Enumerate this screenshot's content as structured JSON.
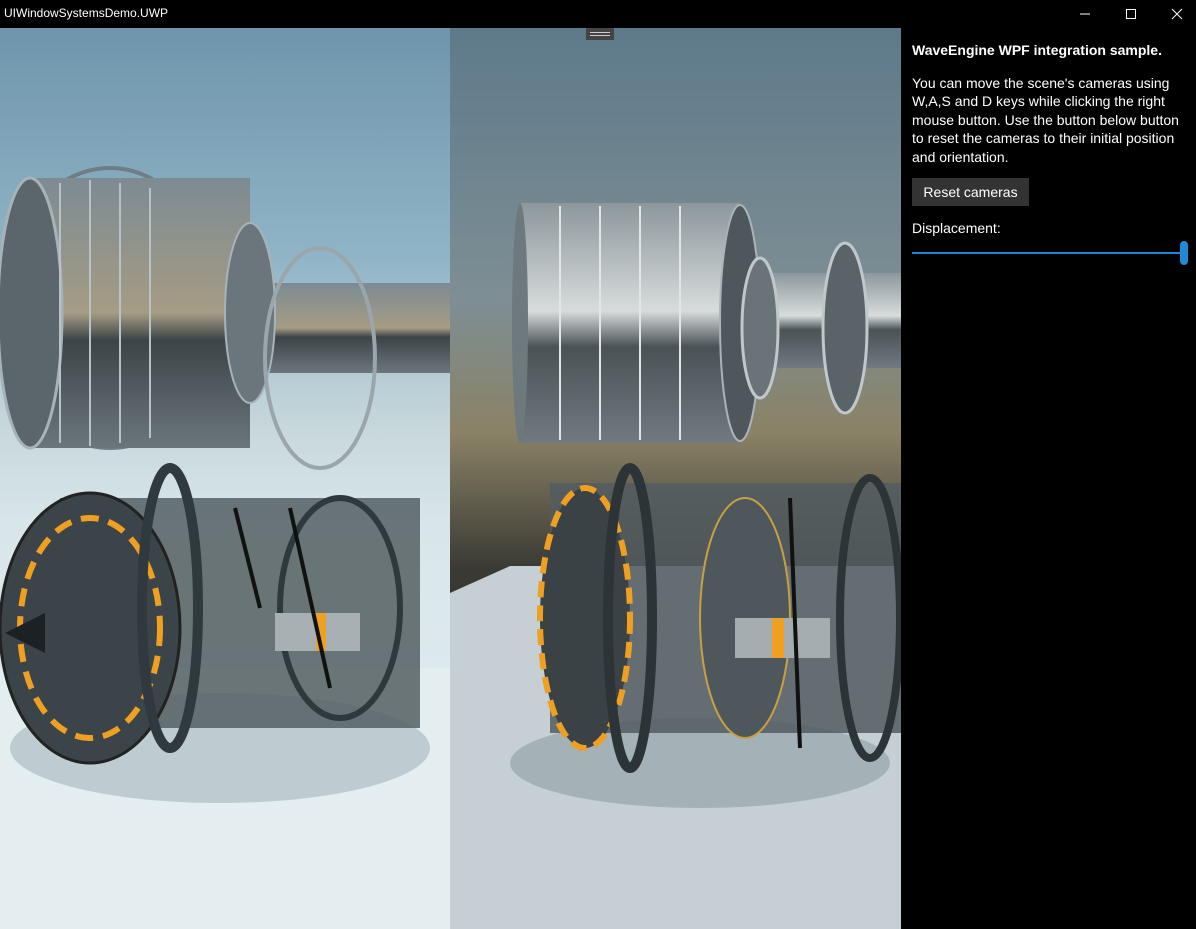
{
  "window": {
    "title": "UIWindowSystemsDemo.UWP",
    "controls": [
      "minimize-icon",
      "maximize-icon",
      "close-icon"
    ]
  },
  "panel": {
    "heading": "WaveEngine WPF integration sample.",
    "description": "You can move the scene's cameras using W,A,S and D keys while clicking the right mouse button. Use the button below button to reset the cameras to their initial position and orientation.",
    "reset_button": "Reset cameras",
    "displacement_label": "Displacement:",
    "displacement_value": 1.0
  },
  "colors": {
    "accent": "#1e8ad6",
    "button_bg": "#333333",
    "panel_bg": "#000000",
    "engine_orange": "#f0a020"
  }
}
